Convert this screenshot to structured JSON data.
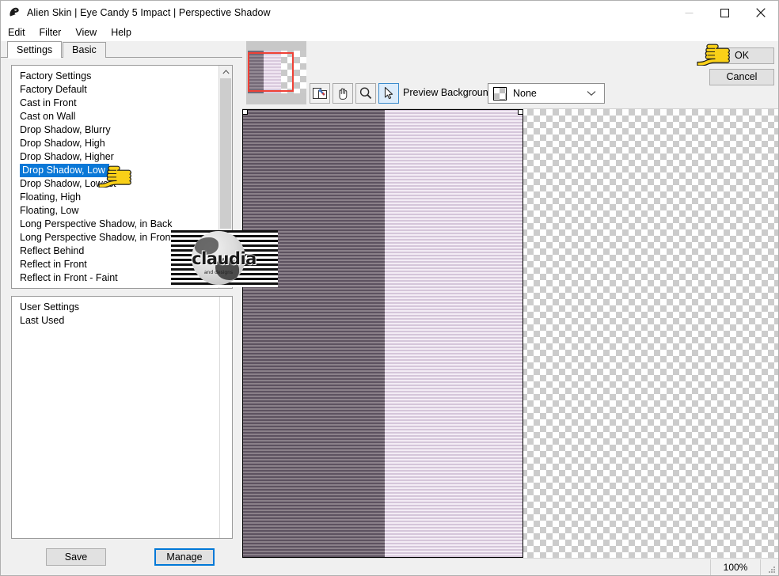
{
  "window": {
    "title": "Alien Skin | Eye Candy 5 Impact | Perspective Shadow",
    "app_icon": "alien-skin-icon",
    "minimize_label": "–",
    "maximize_label": "□",
    "close_label": "✕"
  },
  "menu": {
    "items": [
      {
        "label": "Edit"
      },
      {
        "label": "Filter"
      },
      {
        "label": "View"
      },
      {
        "label": "Help"
      }
    ]
  },
  "tabs": [
    {
      "label": "Settings",
      "active": true
    },
    {
      "label": "Basic",
      "active": false
    }
  ],
  "factory_list": {
    "items": [
      {
        "label": "Factory Settings",
        "selected": false
      },
      {
        "label": "Factory Default",
        "selected": false
      },
      {
        "label": "Cast in Front",
        "selected": false
      },
      {
        "label": "Cast on Wall",
        "selected": false
      },
      {
        "label": "Drop Shadow, Blurry",
        "selected": false
      },
      {
        "label": "Drop Shadow, High",
        "selected": false
      },
      {
        "label": "Drop Shadow, Higher",
        "selected": false
      },
      {
        "label": "Drop Shadow, Low",
        "selected": true
      },
      {
        "label": "Drop Shadow, Lowest",
        "selected": false
      },
      {
        "label": "Floating, High",
        "selected": false
      },
      {
        "label": "Floating, Low",
        "selected": false
      },
      {
        "label": "Long Perspective Shadow, in Back",
        "selected": false
      },
      {
        "label": "Long Perspective Shadow, in Front",
        "selected": false
      },
      {
        "label": "Reflect Behind",
        "selected": false
      },
      {
        "label": "Reflect in Front",
        "selected": false
      },
      {
        "label": "Reflect in Front - Faint",
        "selected": false
      }
    ]
  },
  "user_list": {
    "items": [
      {
        "label": "User Settings"
      },
      {
        "label": "Last Used"
      }
    ]
  },
  "left_buttons": {
    "save_label": "Save",
    "manage_label": "Manage"
  },
  "toolbar": {
    "tools": [
      {
        "name": "navigator-tool",
        "active": false
      },
      {
        "name": "hand-tool",
        "active": false
      },
      {
        "name": "zoom-tool",
        "active": false
      },
      {
        "name": "pointer-tool",
        "active": true
      }
    ],
    "preview_background_label": "Preview Background:",
    "preview_background_value": "None",
    "preview_background_options": [
      "None"
    ]
  },
  "actions": {
    "ok_label": "OK",
    "cancel_label": "Cancel"
  },
  "status": {
    "zoom_level": "100%"
  },
  "watermark": {
    "text": "claudia",
    "subtext": "and designs"
  },
  "colors": {
    "selection_blue": "#0a78d7",
    "focus_blue": "#0078d7",
    "viewport_red": "#ef4136",
    "image_dark": "#5d5260",
    "image_light": "#d5c6da",
    "window_chrome": "#f0f0f0"
  }
}
